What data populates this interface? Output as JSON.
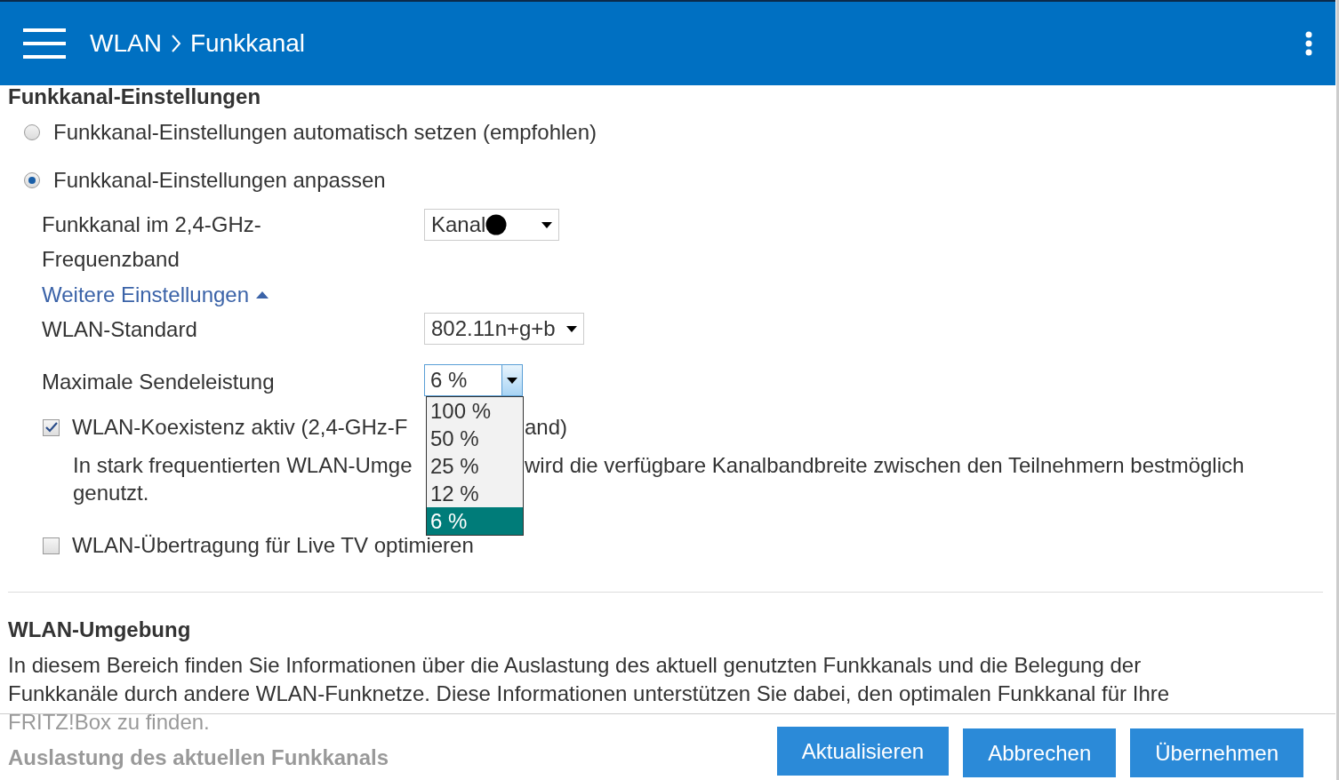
{
  "header": {
    "breadcrumb": [
      "WLAN",
      "Funkkanal"
    ]
  },
  "settings": {
    "title": "Funkkanal-Einstellungen",
    "modes": [
      {
        "label": "Funkkanal-Einstellungen automatisch setzen (empfohlen)",
        "selected": false
      },
      {
        "label": "Funkkanal-Einstellungen anpassen",
        "selected": true
      }
    ],
    "channel": {
      "label": "Funkkanal im 2,4-GHz-Frequenzband",
      "value": "Kanal",
      "redacted": true
    },
    "more_link": {
      "label": "Weitere Einstellungen",
      "expanded": true
    },
    "standard": {
      "label": "WLAN-Standard",
      "value": "802.11n+g+b"
    },
    "power": {
      "label": "Maximale Sendeleistung",
      "value": "6 %",
      "open": true,
      "options": [
        {
          "label": "100 %",
          "selected": false
        },
        {
          "label": "50 %",
          "selected": false
        },
        {
          "label": "25 %",
          "selected": false
        },
        {
          "label": "12 %",
          "selected": false
        },
        {
          "label": "6 %",
          "selected": true
        }
      ]
    },
    "checkboxes": [
      {
        "label_parts": [
          "WLAN-Koexistenz aktiv (2,4-GHz-F",
          "and)"
        ],
        "checked": true,
        "description_lines": [
          [
            "In stark frequentierten WLAN-Umge",
            "wird die verfügbare Kanalbandbreite zwischen den Teilnehmern bestmöglich"
          ],
          [
            "genutzt."
          ]
        ]
      },
      {
        "label_parts": [
          "WLAN-Übertragung für Live TV optimieren"
        ],
        "checked": false
      }
    ]
  },
  "environment": {
    "title": "WLAN-Umgebung",
    "text": "In diesem Bereich finden Sie Informationen über die Auslastung des aktuell genutzten Funkkanals und die Belegung der Funkkanäle durch andere WLAN-Funknetze. Diese Informationen unterstützen Sie dabei, den optimalen Funkkanal für Ihre FRITZ!Box zu finden.",
    "subtitle": "Auslastung des aktuellen Funkkanals"
  },
  "buttons": [
    "Aktualisieren",
    "Abbrechen",
    "Übernehmen"
  ]
}
